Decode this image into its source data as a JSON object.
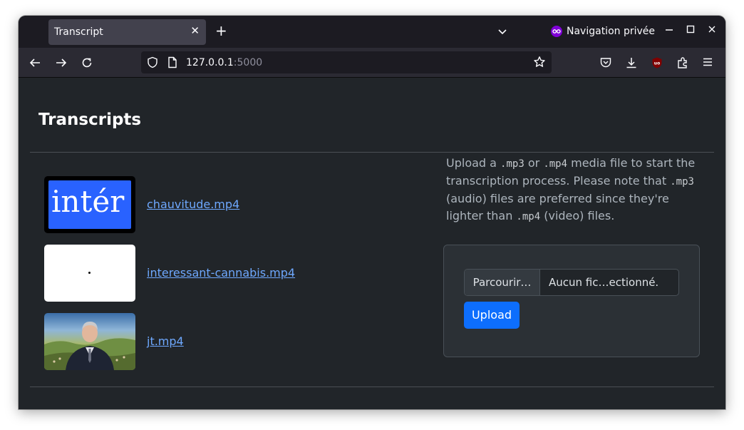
{
  "browser": {
    "tab_title": "Transcript",
    "private_label": "Navigation privée",
    "url_host": "127.0.0.1",
    "url_port": ":5000"
  },
  "page": {
    "title": "Transcripts",
    "items": [
      {
        "name": "chauvitude.mp4",
        "thumb_text": "intér"
      },
      {
        "name": "interessant-cannabis.mp4"
      },
      {
        "name": "jt.mp4"
      }
    ],
    "description": {
      "p1": "Upload a ",
      "c1": ".mp3",
      "p2": " or ",
      "c2": ".mp4",
      "p3": " media file to start the transcription process. Please note that ",
      "c3": ".mp3",
      "p4": " (audio) files are preferred since they're lighter than ",
      "c4": ".mp4",
      "p5": " (video) files."
    },
    "form": {
      "browse_label": "Parcourir…",
      "file_status": "Aucun fic…ectionné.",
      "upload_label": "Upload"
    }
  },
  "colors": {
    "accent": "#0d6efd",
    "link": "#6ea8fe",
    "private": "#8000d7"
  }
}
